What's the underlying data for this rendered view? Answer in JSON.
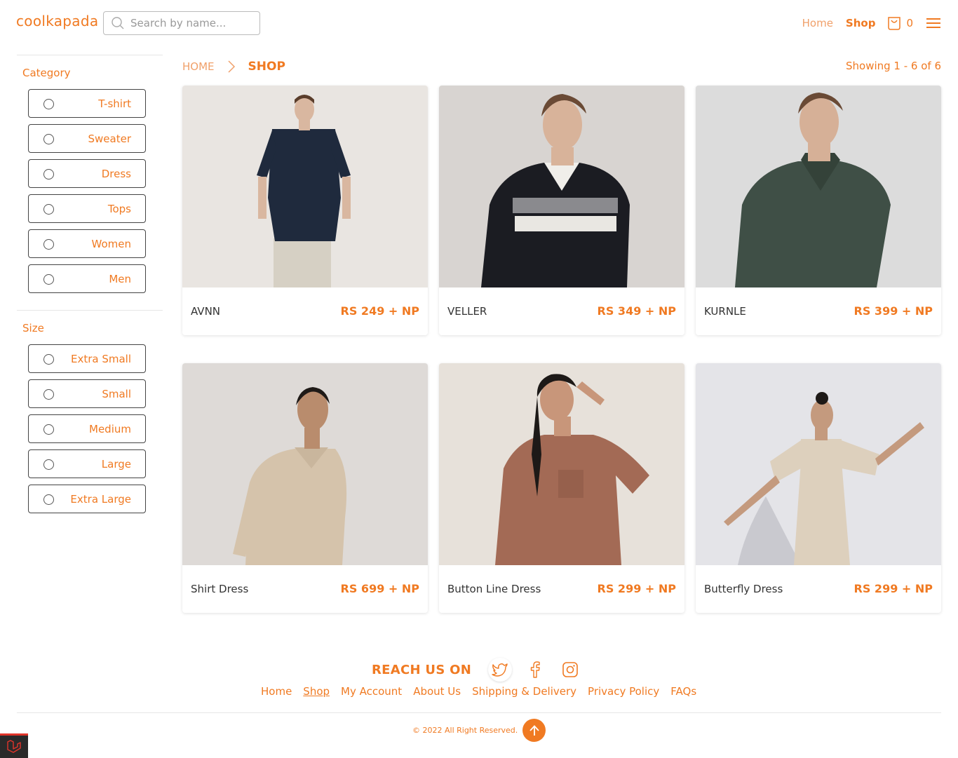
{
  "header": {
    "logo": "coolkapada",
    "search_placeholder": "Search by name...",
    "nav_home": "Home",
    "nav_shop": "Shop",
    "cart_count": "0"
  },
  "sidebar": {
    "category_title": "Category",
    "categories": [
      "T-shirt",
      "Sweater",
      "Dress",
      "Tops",
      "Women",
      "Men"
    ],
    "size_title": "Size",
    "sizes": [
      "Extra Small",
      "Small",
      "Medium",
      "Large",
      "Extra Large"
    ]
  },
  "breadcrumb": {
    "home": "HOME",
    "current": "SHOP"
  },
  "results": {
    "showing": "Showing 1 - 6 of 6"
  },
  "products": [
    {
      "name": "AVNN",
      "price": "RS 249 + NP"
    },
    {
      "name": "VELLER",
      "price": "RS 349 + NP"
    },
    {
      "name": "KURNLE",
      "price": "RS 399 + NP"
    },
    {
      "name": "Shirt Dress",
      "price": "RS 699 + NP"
    },
    {
      "name": "Button Line Dress",
      "price": "RS 299 + NP"
    },
    {
      "name": "Butterfly Dress",
      "price": "RS 299 + NP"
    }
  ],
  "footer": {
    "reach_title": "REACH US ON",
    "social_icons": [
      "twitter-icon",
      "facebook-icon",
      "instagram-icon"
    ],
    "links": [
      "Home",
      "Shop",
      "My Account",
      "About Us",
      "Shipping & Delivery",
      "Privacy Policy",
      "FAQs"
    ],
    "copyright": "© 2022 All Right Reserved."
  },
  "colors": {
    "accent": "#f07a22",
    "accent_light": "#f0a06a"
  }
}
